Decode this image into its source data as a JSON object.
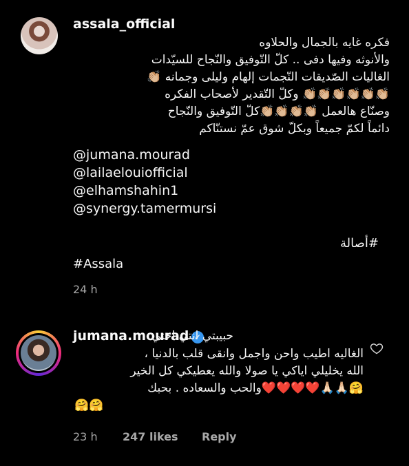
{
  "caption": {
    "username": "assala_official",
    "lines": [
      "فكره غايه بالجمال والحلاوه",
      "والأنوثه وفيها دفى .. كلّ التّوفيق والنّجاح للسيّدات",
      "الغاليات  الصّديقات النّجمات إلهام وليلى وجمانه 👏🏼",
      "👏🏼👏🏼👏🏼👏🏼👏🏼👏🏼 وكلّ التّقدير لأصحاب الفكره",
      "وصنّاع هالعمل 👏🏼👏🏼👏🏼👏🏼كلّ التّوفيق والنّجاح",
      "دائماً لكمّ جميعاً وبكلّ شوق عمّ نستنّاكم"
    ],
    "mentions": [
      "@jumana.mourad",
      "@lailaelouiofficial",
      "@elhamshahin1",
      "@synergy.tamermursi"
    ],
    "hashtag_arabic": "#أصالة",
    "hashtag_latin": "#Assala",
    "time": "24 h"
  },
  "reply": {
    "username": "jumana.mourad",
    "first_line": "حبيبتي انتي اختي",
    "lines": [
      "الغاليه اطيب واحن واجمل وانقى قلب بالدنيا ،",
      "الله يخليلي اياكي يا صولا والله يعطيكي كل الخير",
      "🤗🙏🏻🙏🏻❤️❤️❤️❤️والحب والسعاده . بحبك",
      "🤗🤗"
    ],
    "time": "23 h",
    "likes": "247 likes",
    "reply_label": "Reply"
  },
  "icons": {
    "verified": "verified-badge-icon",
    "like": "heart-outline-icon",
    "verified_color": "#3897f0"
  }
}
